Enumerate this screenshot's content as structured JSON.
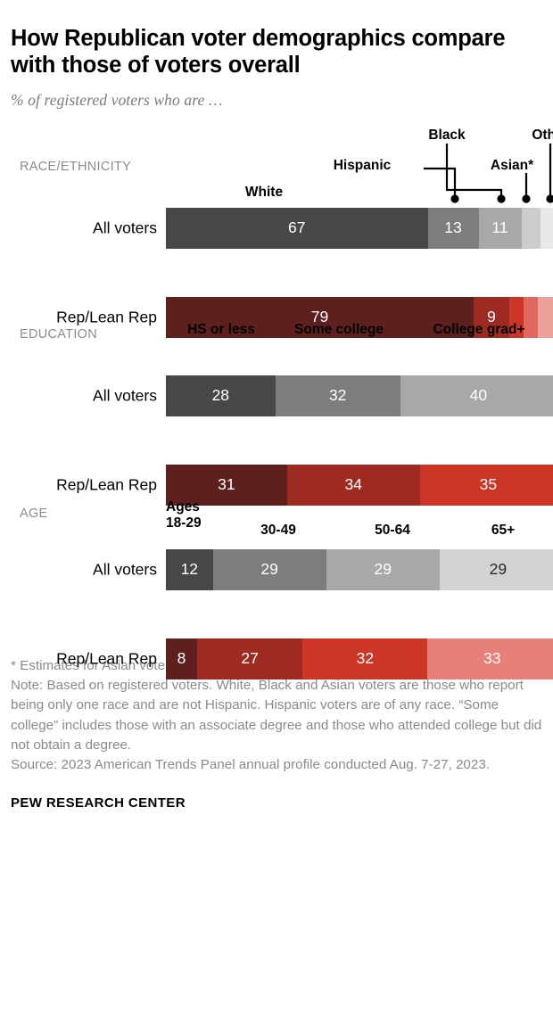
{
  "header": {
    "title": "How Republican voter demographics compare with those of voters overall",
    "subtitle": "% of registered voters who are …"
  },
  "sections": {
    "race": {
      "label": "RACE/ETHNICITY",
      "callouts": {
        "white": "White",
        "hispanic": "Hispanic",
        "black": "Black",
        "asian": "Asian*",
        "other": "Other"
      },
      "rows": [
        {
          "label": "All voters"
        },
        {
          "label": "Rep/Lean Rep"
        }
      ]
    },
    "education": {
      "label": "EDUCATION",
      "callouts": {
        "hs": "HS or less",
        "some": "Some college",
        "grad": "College grad+"
      },
      "rows": [
        {
          "label": "All voters"
        },
        {
          "label": "Rep/Lean Rep"
        }
      ]
    },
    "age": {
      "label": "AGE",
      "callouts": {
        "a1": "Ages 18-29",
        "a2": "30-49",
        "a3": "50-64",
        "a4": "65+"
      },
      "rows": [
        {
          "label": "All voters"
        },
        {
          "label": "Rep/Lean Rep"
        }
      ]
    }
  },
  "footnotes": {
    "asterisk": "* Estimates for Asian voters are representative of English speakers only.",
    "note": "Note: Based on registered voters. White, Black and Asian voters are those who report being only one race and are not Hispanic. Hispanic voters are of any race. “Some college” includes those with an associate degree and those who attended college but did not obtain a degree.",
    "source": "Source: 2023 American Trends Panel annual profile conducted Aug. 7-27, 2023.",
    "brand": "PEW RESEARCH CENTER"
  },
  "palette": {
    "grey1": "#474747",
    "grey2": "#7d7d7d",
    "grey3": "#a8a8a8",
    "grey4": "#cdcdcd",
    "grey5": "#e8e8e8",
    "red1": "#5e201e",
    "red2": "#9e2a22",
    "red3": "#cd3527",
    "red4": "#e2685f",
    "red5": "#eea09b"
  },
  "chart_data": {
    "type": "bar",
    "subtype": "stacked-horizontal-100",
    "title": "How Republican voter demographics compare with those of voters overall",
    "subtitle": "% of registered voters who are …",
    "xlabel": "",
    "ylabel": "",
    "xlim": [
      0,
      100
    ],
    "grid": false,
    "legend": "inline-callout-labels",
    "panels": [
      {
        "name": "RACE/ETHNICITY",
        "categories": [
          "White",
          "Hispanic",
          "Black",
          "Asian*",
          "Other"
        ],
        "series": [
          {
            "name": "All voters",
            "values": [
              67,
              13,
              11,
              5,
              4
            ],
            "labeled": [
              67,
              13,
              11,
              null,
              null
            ],
            "colors": [
              "#474747",
              "#7d7d7d",
              "#a8a8a8",
              "#cdcdcd",
              "#e8e8e8"
            ]
          },
          {
            "name": "Rep/Lean Rep",
            "values": [
              79,
              9,
              4,
              4,
              4
            ],
            "labeled": [
              79,
              9,
              null,
              null,
              null
            ],
            "colors": [
              "#5e201e",
              "#9e2a22",
              "#cd3527",
              "#e2685f",
              "#eea09b"
            ]
          }
        ]
      },
      {
        "name": "EDUCATION",
        "categories": [
          "HS or less",
          "Some college",
          "College grad+"
        ],
        "series": [
          {
            "name": "All voters",
            "values": [
              28,
              32,
              40
            ],
            "labeled": [
              28,
              32,
              40
            ],
            "colors": [
              "#474747",
              "#7d7d7d",
              "#a8a8a8"
            ]
          },
          {
            "name": "Rep/Lean Rep",
            "values": [
              31,
              34,
              35
            ],
            "labeled": [
              31,
              34,
              35
            ],
            "colors": [
              "#5e201e",
              "#9e2a22",
              "#cd3527"
            ]
          }
        ]
      },
      {
        "name": "AGE",
        "categories": [
          "Ages 18-29",
          "30-49",
          "50-64",
          "65+"
        ],
        "series": [
          {
            "name": "All voters",
            "values": [
              12,
              29,
              29,
              29
            ],
            "labeled": [
              12,
              29,
              29,
              29
            ],
            "colors": [
              "#474747",
              "#7d7d7d",
              "#a8a8a8",
              "#d2d2d2"
            ]
          },
          {
            "name": "Rep/Lean Rep",
            "values": [
              8,
              27,
              32,
              33
            ],
            "labeled": [
              8,
              27,
              32,
              33
            ],
            "colors": [
              "#5e201e",
              "#9e2a22",
              "#cd3527",
              "#e8807a"
            ]
          }
        ]
      }
    ]
  }
}
